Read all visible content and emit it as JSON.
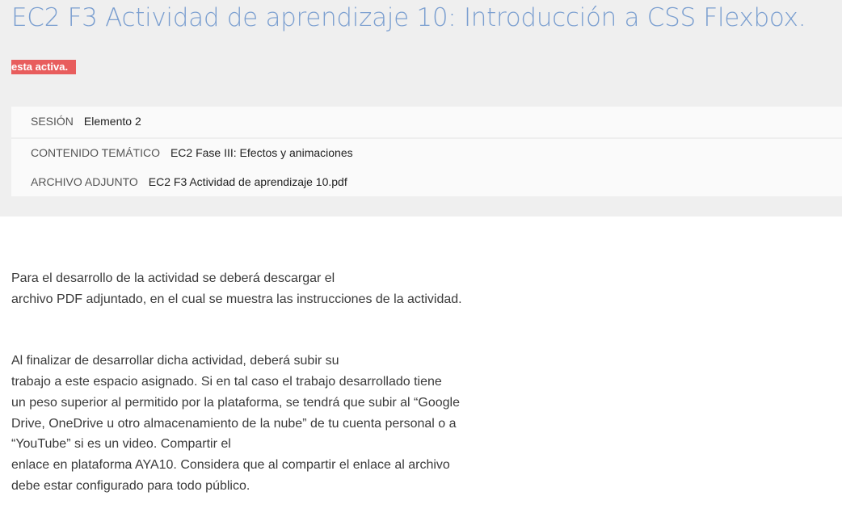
{
  "activity": {
    "title": "EC2 F3 Actividad de aprendizaje 10: Introducción a CSS Flexbox.",
    "status_badge": "esta activa."
  },
  "meta": [
    {
      "label": "SESIÓN",
      "value": "Elemento 2"
    },
    {
      "label": "CONTENIDO TEMÁTICO",
      "value": "EC2 Fase III: Efectos y animaciones"
    },
    {
      "label": "ARCHIVO ADJUNTO",
      "value": "EC2 F3 Actividad de aprendizaje 10.pdf"
    }
  ],
  "body": {
    "paragraph1": [
      "Para el desarrollo de la actividad se deberá descargar el",
      "archivo PDF adjuntado, en el cual se muestra las instrucciones de la actividad."
    ],
    "paragraph2": [
      "Al finalizar de desarrollar dicha actividad, deberá subir su",
      "trabajo a este espacio asignado. Si en tal caso el trabajo desarrollado tiene",
      "un peso superior al permitido por la plataforma, se tendrá que subir al “Google",
      "Drive, OneDrive u otro almacenamiento de la nube” de tu cuenta personal o a",
      "“YouTube” si es un video.  Compartir el",
      "enlace en plataforma AYA10. Considera que al compartir el enlace al archivo",
      "debe estar configurado para todo público."
    ]
  },
  "colors": {
    "title": "#7b9fd0",
    "badge": "#e85d5d",
    "header_band": "#efefef"
  }
}
